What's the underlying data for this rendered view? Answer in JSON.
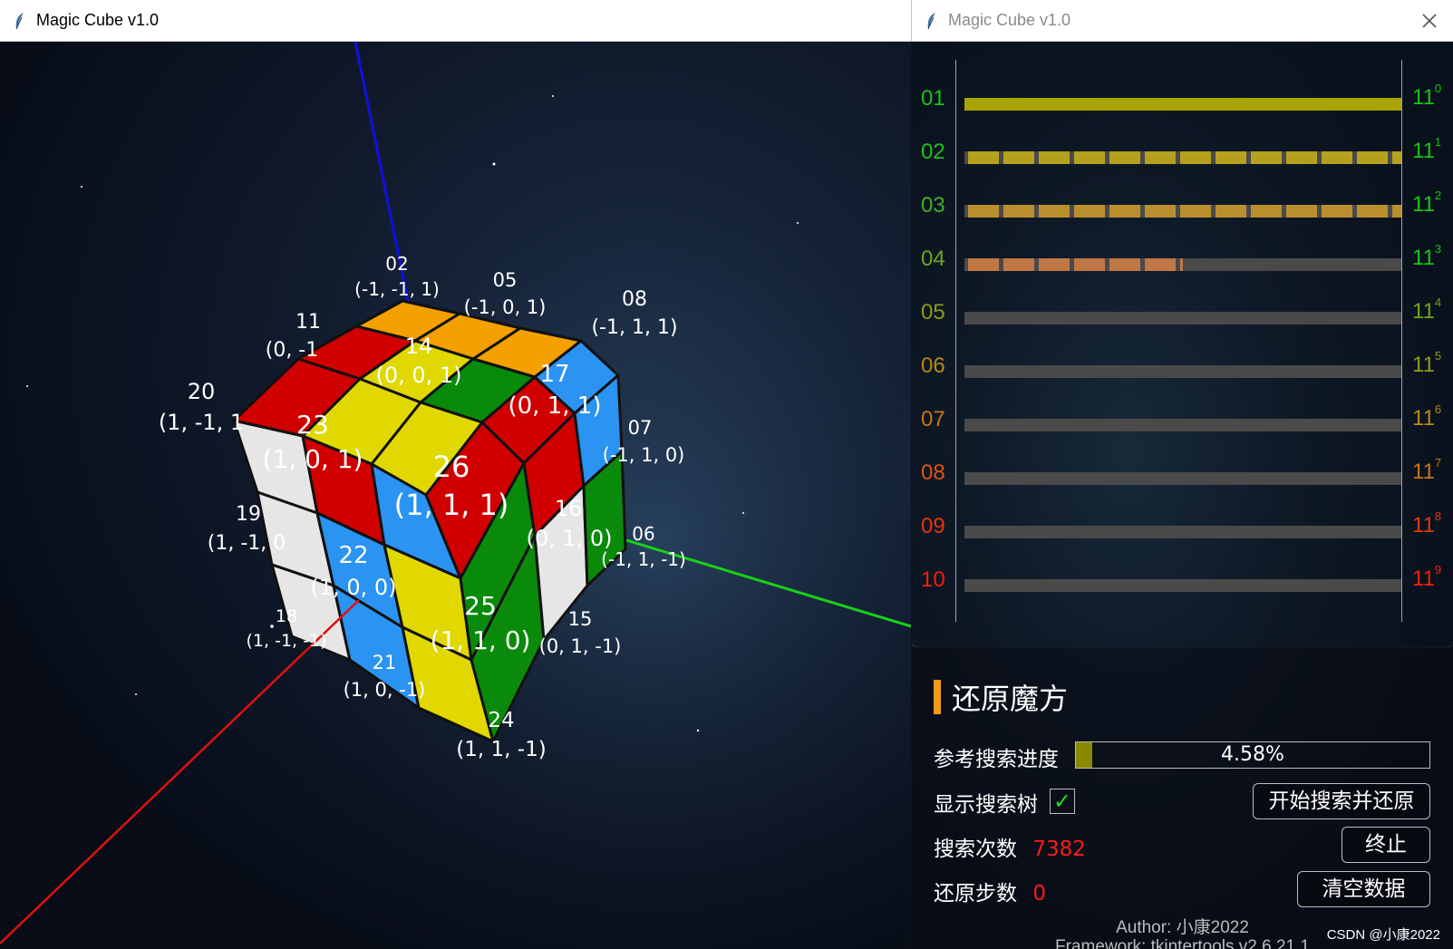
{
  "left_window": {
    "title": "Magic Cube v1.0"
  },
  "right_window": {
    "title": "Magic Cube v1.0"
  },
  "cube_labels": [
    {
      "id": "02",
      "coord": "(-1, -1, 1)"
    },
    {
      "id": "05",
      "coord": "(-1, 0, 1)"
    },
    {
      "id": "08",
      "coord": "(-1, 1, 1)"
    },
    {
      "id": "11",
      "coord": "(0, -1"
    },
    {
      "id": "14",
      "coord": "(0, 0, 1)"
    },
    {
      "id": "17",
      "coord": "(0, 1, 1)"
    },
    {
      "id": "20",
      "coord": "(1, -1, 1"
    },
    {
      "id": "23",
      "coord": "(1, 0, 1)"
    },
    {
      "id": "26",
      "coord": "(1, 1, 1)"
    },
    {
      "id": "07",
      "coord": "(-1, 1, 0)"
    },
    {
      "id": "19",
      "coord": "(1, -1, 0"
    },
    {
      "id": "22",
      "coord": "(1, 0, 0)"
    },
    {
      "id": "16",
      "coord": "(0, 1, 0)"
    },
    {
      "id": "06",
      "coord": "(-1, 1, -1)"
    },
    {
      "id": "25",
      "coord": "(1, 1, 0)"
    },
    {
      "id": "18",
      "coord": "(1, -1, -1)"
    },
    {
      "id": "15",
      "coord": "(0, 1, -1)"
    },
    {
      "id": "21",
      "coord": "(1, 0, -1)"
    },
    {
      "id": "24",
      "coord": "(1, 1, -1)"
    }
  ],
  "search_tree": {
    "rows": [
      {
        "level": "01",
        "exp": "0",
        "progress": 1.0,
        "fill_color": "#a9a300",
        "dashed": false,
        "level_color": "#19c219"
      },
      {
        "level": "02",
        "exp": "1",
        "progress": 1.0,
        "fill_color": "#b5a11d",
        "dashed": true,
        "level_color": "#19c219"
      },
      {
        "level": "03",
        "exp": "2",
        "progress": 1.0,
        "fill_color": "#b98f2e",
        "dashed": true,
        "level_color": "#41b021"
      },
      {
        "level": "04",
        "exp": "3",
        "progress": 0.5,
        "fill_color": "#c07746",
        "dashed": true,
        "level_color": "#6fa51d"
      },
      {
        "level": "05",
        "exp": "4",
        "progress": 0,
        "fill_color": "#c07746",
        "dashed": false,
        "level_color": "#8f9a17"
      },
      {
        "level": "06",
        "exp": "5",
        "progress": 0,
        "fill_color": "#c07746",
        "dashed": false,
        "level_color": "#b58a14"
      },
      {
        "level": "07",
        "exp": "6",
        "progress": 0,
        "fill_color": "#c07746",
        "dashed": false,
        "level_color": "#cc7312"
      },
      {
        "level": "08",
        "exp": "7",
        "progress": 0,
        "fill_color": "#c07746",
        "dashed": false,
        "level_color": "#dd5510"
      },
      {
        "level": "09",
        "exp": "8",
        "progress": 0,
        "fill_color": "#c07746",
        "dashed": false,
        "level_color": "#e8350e"
      },
      {
        "level": "10",
        "exp": "9",
        "progress": 0,
        "fill_color": "#c07746",
        "dashed": false,
        "level_color": "#f0200c"
      }
    ],
    "exp_base": "11",
    "exp_colors": [
      "#19c219",
      "#19c219",
      "#19c219",
      "#19c219",
      "#6fa51d",
      "#8f9a17",
      "#b58a14",
      "#cc7312",
      "#dd3a10",
      "#f0200c"
    ]
  },
  "panel": {
    "title": "还原魔方",
    "progress_label": "参考搜索进度",
    "progress_value": 0.0458,
    "progress_text": "4.58%",
    "show_tree_label": "显示搜索树",
    "show_tree_check": "✓",
    "search_count_label": "搜索次数",
    "search_count_value": "7382",
    "restore_steps_label": "还原步数",
    "restore_steps_value": "0",
    "start_button": "开始搜索并还原",
    "stop_button": "终止",
    "clear_button": "清空数据",
    "author": "Author: 小康2022",
    "framework": "Framework: tkintertools v2.6.21.1",
    "watermark": "CSDN @小康2022"
  }
}
